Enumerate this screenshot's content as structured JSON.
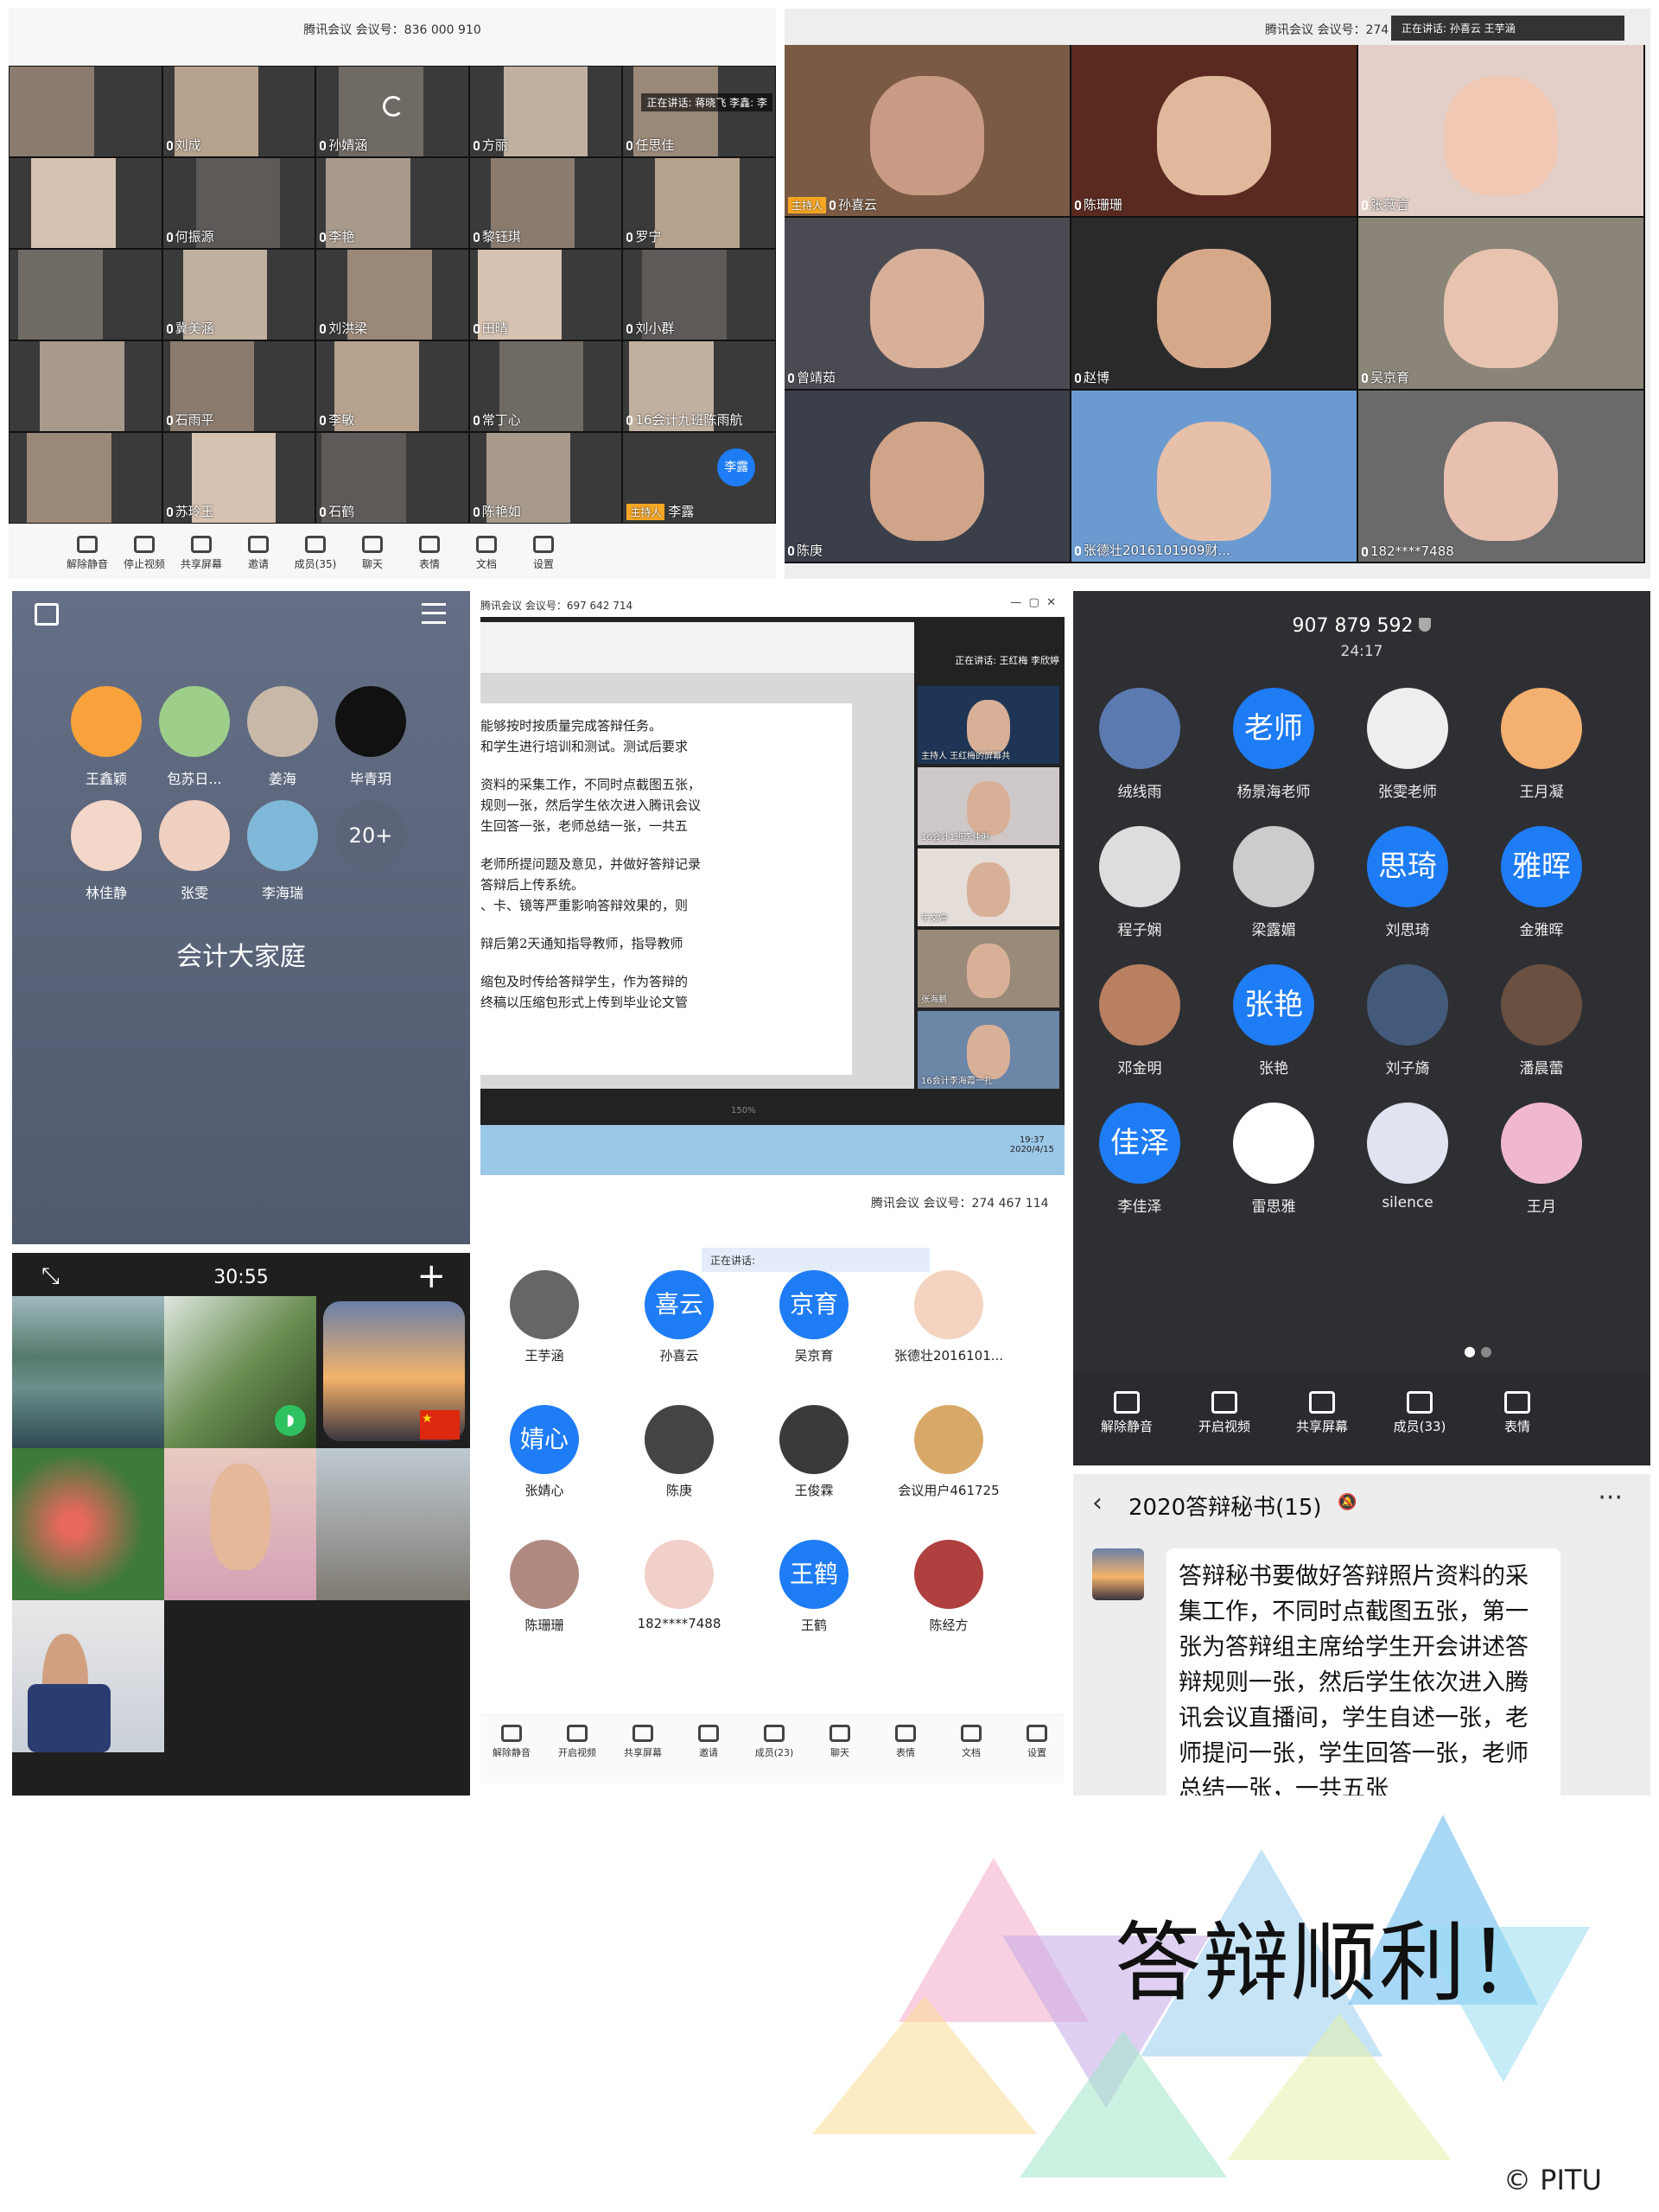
{
  "p1": {
    "title": "腾讯会议 会议号：836 000 910",
    "speaking": "正在讲话: 蒋晓飞 李鑫: 李",
    "tiles": [
      "",
      "刘成",
      "孙婧涵",
      "方丽",
      "任思佳",
      "",
      "何振源",
      "李艳",
      "黎钰琪",
      "罗宁",
      "",
      "冀美涵",
      "刘洪梁",
      "田晴",
      "刘小群",
      "",
      "石雨平",
      "李敏",
      "常丁心",
      "16会计九班陈雨航",
      "",
      "苏玲玉",
      "石鹤",
      "陈艳如",
      "李露"
    ],
    "host_label": "主持人",
    "host_avatar": "李露",
    "toolbar": [
      "解除静音",
      "停止视频",
      "共享屏幕",
      "邀请",
      "成员(35)",
      "聊天",
      "表情",
      "文档",
      "设置"
    ]
  },
  "p2": {
    "title": "腾讯会议 会议号：274",
    "speaking": "正在讲话: 孙喜云 王芋涵",
    "tiles": [
      "孙喜云",
      "陈珊珊",
      "张薇言",
      "曾靖茹",
      "赵博",
      "吴京育",
      "陈庚",
      "张德壮2016101909财...",
      "182****7488"
    ],
    "host_label": "主持人"
  },
  "p3": {
    "group": "会计大家庭",
    "more": "20+",
    "members": [
      "王鑫颖",
      "包苏日...",
      "姜海",
      "毕青玥",
      "林佳静",
      "张雯",
      "李海瑞"
    ]
  },
  "p4": {
    "title": "腾讯会议 会议号：697 642 714",
    "speaking": "正在讲话: 王红梅 李欣婷",
    "doc_lines": [
      "能够按时按质量完成答辩任务。",
      "和学生进行培训和测试。测试后要求",
      "资料的采集工作，不同时点截图五张，",
      "规则一张，然后学生依次进入腾讯会议",
      "生回答一张，老师总结一张，一共五",
      "老师所提问题及意见，并做好答辩记录",
      "答辩后上传系统。",
      "、卡、镜等严重影响答辩效果的，则",
      "辩后第2天通知指导教师，指导教师",
      "缩包及时传给答辩学生，作为答辩的",
      "终稿以压缩包形式上传到毕业论文管"
    ],
    "side": [
      "主持人 王红梅的屏幕共",
      "16会计1班李佳俐",
      "牛文婷",
      "张海鹏",
      "16会计李海霞一孔"
    ],
    "zoom": "150%",
    "time": "19:37",
    "date": "2020/4/15"
  },
  "p5": {
    "meeting": "907 879 592",
    "timer": "24:17",
    "members": [
      [
        "绒线雨",
        ""
      ],
      [
        "杨景海老师",
        "老师"
      ],
      [
        "张雯老师",
        ""
      ],
      [
        "王月凝",
        ""
      ],
      [
        "程子娴",
        ""
      ],
      [
        "梁露媚",
        ""
      ],
      [
        "刘思琦",
        "思琦"
      ],
      [
        "金雅晖",
        "雅晖"
      ],
      [
        "邓金明",
        ""
      ],
      [
        "张艳",
        "张艳"
      ],
      [
        "刘子旖",
        ""
      ],
      [
        "潘晨蕾",
        ""
      ],
      [
        "李佳泽",
        "佳泽"
      ],
      [
        "雷思雅",
        ""
      ],
      [
        "silence",
        ""
      ],
      [
        "王月",
        ""
      ]
    ],
    "toolbar": [
      "解除静音",
      "开启视频",
      "共享屏幕",
      "成员(33)",
      "表情"
    ]
  },
  "p6": {
    "timer": "30:55"
  },
  "p7": {
    "title": "腾讯会议 会议号：274 467 114",
    "speaking": "正在讲话:",
    "members": [
      [
        "王芋涵",
        ""
      ],
      [
        "孙喜云",
        "喜云"
      ],
      [
        "吴京育",
        "京育"
      ],
      [
        "张德壮2016101...",
        ""
      ],
      [
        "张婧心",
        "婧心"
      ],
      [
        "陈庚",
        ""
      ],
      [
        "王俊霖",
        ""
      ],
      [
        "会议用户461725",
        ""
      ],
      [
        "陈珊珊",
        ""
      ],
      [
        "182****7488",
        ""
      ],
      [
        "王鹤",
        "王鹤"
      ],
      [
        "陈经方",
        ""
      ]
    ],
    "toolbar": [
      "解除静音",
      "开启视频",
      "共享屏幕",
      "邀请",
      "成员(23)",
      "聊天",
      "表情",
      "文档",
      "设置"
    ]
  },
  "p8": {
    "chat_title": "2020答辩秘书(15)",
    "message": "答辩秘书要做好答辩照片资料的采集工作，不同时点截图五张，第一张为答辩组主席给学生开会讲述答辩规则一张，然后学生依次进入腾讯会议直播间，学生自述一张，老师提问一张，学生回答一张，老师总结一张，一共五张"
  },
  "footer": {
    "slogan": "答辩顺利！",
    "credit": "© PITU"
  },
  "colors": {
    "blue": "#1e7cf5",
    "dark": "#2e2f33",
    "host": "#f5a623"
  }
}
